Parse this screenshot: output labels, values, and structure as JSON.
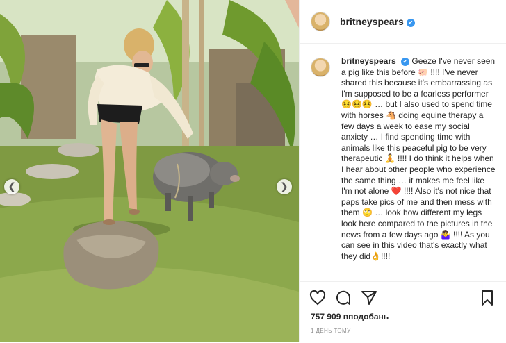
{
  "post": {
    "username": "britneyspears",
    "verified_mark": "✔",
    "caption": {
      "username": "britneyspears",
      "text": "Geeze I've never seen a pig like this before 🐖 !!!! I've never shared this because it's embarrassing as I'm supposed to be a fearless performer 😣😣😣 … but I also used to spend time with horses 🐴 doing equine therapy a few days a week to ease my social anxiety … I find spending time with animals like this peaceful pig to be very therapeutic 🧘 !!!! I do think it helps when I hear about other people who experience the same thing … it makes me feel like I'm not alone ❤️ !!!! Also it's not nice that paps take pics of me and then mess with them 🙄 … look how different my legs look here compared to the pictures in the news from a few days ago 🤷‍♀️ !!!! As you can see in this video that's exactly what they did👌!!!!"
    },
    "likes": "757 909 вподобань",
    "timestamp": "1 ДЕНЬ ТОМУ"
  },
  "media": {
    "prev_icon": "❮",
    "next_icon": "❯"
  },
  "icons": {
    "like": "heart-icon",
    "comment": "comment-icon",
    "share": "share-icon",
    "save": "bookmark-icon"
  },
  "colors": {
    "verified": "#3897f0",
    "text": "#262626",
    "muted": "#8e8e8e"
  }
}
